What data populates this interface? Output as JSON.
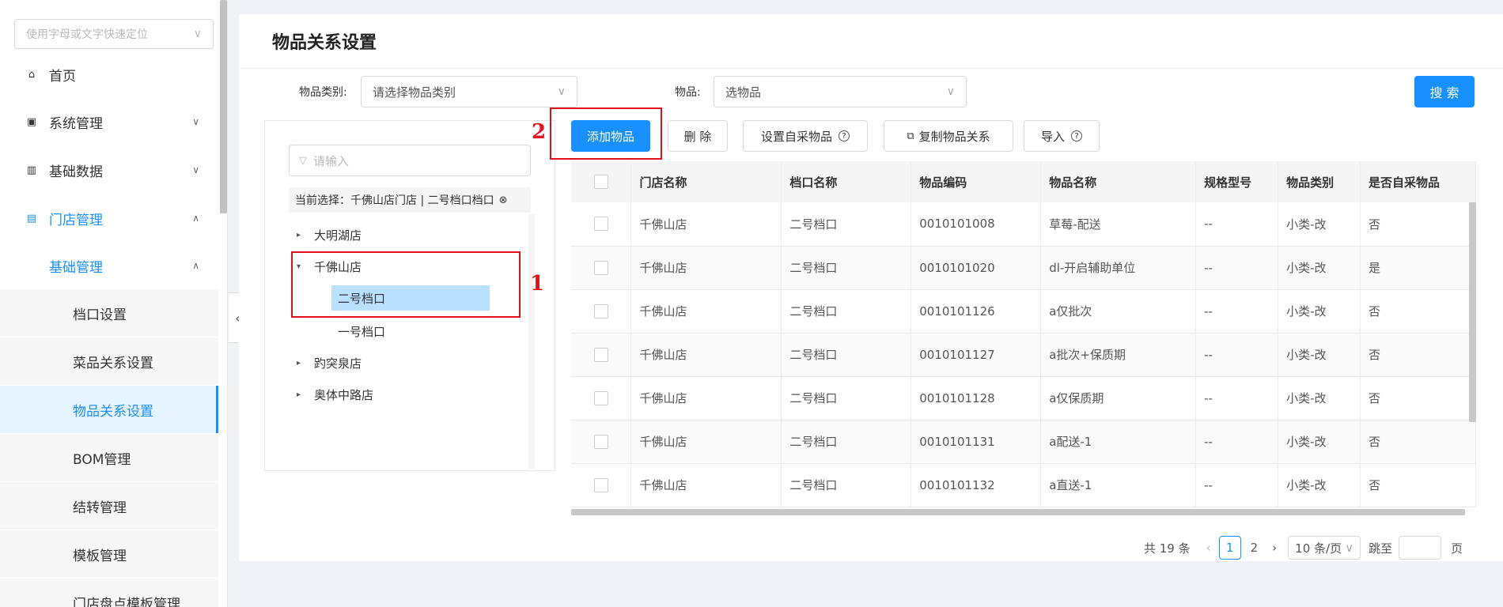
{
  "sidebar": {
    "search_placeholder": "使用字母或文字快速定位",
    "items": [
      {
        "label": "首页",
        "icon": "home-icon"
      },
      {
        "label": "系统管理",
        "icon": "monitor-icon"
      },
      {
        "label": "基础数据",
        "icon": "chart-icon"
      },
      {
        "label": "门店管理",
        "icon": "store-icon"
      }
    ],
    "sub_group": "基础管理",
    "leaves": [
      "档口设置",
      "菜品关系设置",
      "物品关系设置",
      "BOM管理",
      "结转管理",
      "模板管理",
      "门店盘点模板管理"
    ],
    "selected_leaf": "物品关系设置"
  },
  "main": {
    "title": "物品关系设置",
    "filters": {
      "category_label": "物品类别:",
      "category_placeholder": "请选择物品类别",
      "item_label": "物品:",
      "item_placeholder": "选物品",
      "search_button": "搜 索"
    },
    "tree": {
      "search_placeholder": "请输入",
      "current_selection": "当前选择：千佛山店门店 | 二号档口档口",
      "nodes": [
        "大明湖店",
        "千佛山店",
        "二号档口",
        "一号档口",
        "趵突泉店",
        "奥体中路店"
      ]
    },
    "toolbar": {
      "add": "添加物品",
      "delete": "删 除",
      "self_purchase": "设置自采物品",
      "copy": "复制物品关系",
      "import": "导入"
    },
    "table": {
      "headers": [
        "门店名称",
        "档口名称",
        "物品编码",
        "物品名称",
        "规格型号",
        "物品类别",
        "是否自采物品"
      ],
      "rows": [
        [
          "千佛山店",
          "二号档口",
          "0010101008",
          "草莓-配送",
          "--",
          "小类-改",
          "否"
        ],
        [
          "千佛山店",
          "二号档口",
          "0010101020",
          "dl-开启辅助单位",
          "--",
          "小类-改",
          "是"
        ],
        [
          "千佛山店",
          "二号档口",
          "0010101126",
          "a仅批次",
          "--",
          "小类-改",
          "否"
        ],
        [
          "千佛山店",
          "二号档口",
          "0010101127",
          "a批次+保质期",
          "--",
          "小类-改",
          "否"
        ],
        [
          "千佛山店",
          "二号档口",
          "0010101128",
          "a仅保质期",
          "--",
          "小类-改",
          "否"
        ],
        [
          "千佛山店",
          "二号档口",
          "0010101131",
          "a配送-1",
          "--",
          "小类-改",
          "否"
        ],
        [
          "千佛山店",
          "二号档口",
          "0010101132",
          "a直送-1",
          "--",
          "小类-改",
          "否"
        ]
      ]
    },
    "pagination": {
      "total": "共 19 条",
      "current": "1",
      "next": "2",
      "page_size": "10 条/页",
      "jump_label": "跳至",
      "page_suffix": "页"
    }
  },
  "annotations": {
    "one": "1",
    "two": "2"
  },
  "colors": {
    "accent": "#1890ff",
    "annotation": "#e0101a"
  }
}
